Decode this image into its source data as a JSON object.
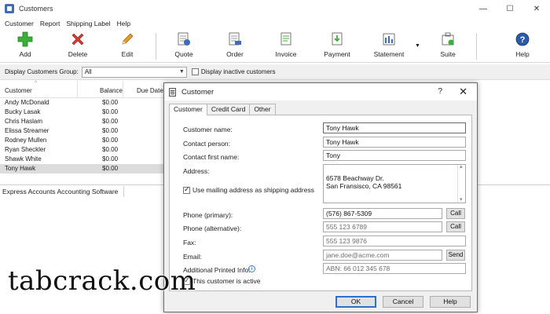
{
  "window": {
    "title": "Customers",
    "controls": {
      "minimize": "—",
      "maximize": "☐",
      "close": "✕"
    }
  },
  "menu": [
    "Customer",
    "Report",
    "Shipping Label",
    "Help"
  ],
  "toolbar": {
    "add": "Add",
    "delete": "Delete",
    "edit": "Edit",
    "quote": "Quote",
    "order": "Order",
    "invoice": "Invoice",
    "payment": "Payment",
    "statement": "Statement",
    "suite": "Suite",
    "help": "Help",
    "colors": {
      "add": "#3cae3c",
      "delete": "#d63b2f",
      "edit": "#e89d28",
      "doc": "#3f6db4",
      "help": "#2a5aa8"
    }
  },
  "filter": {
    "group_label": "Display Customers Group:",
    "group_value": "All",
    "inactive_label": "Display inactive customers"
  },
  "list": {
    "columns": [
      "Customer",
      "Balance",
      "Due Date"
    ],
    "rows": [
      {
        "name": "Andy McDonald",
        "balance": "$0.00"
      },
      {
        "name": "Bucky Lasak",
        "balance": "$0.00"
      },
      {
        "name": "Chris Haslam",
        "balance": "$0.00"
      },
      {
        "name": "Elissa Streamer",
        "balance": "$0.00"
      },
      {
        "name": "Rodney Mullen",
        "balance": "$0.00"
      },
      {
        "name": "Ryan Sheckler",
        "balance": "$0.00"
      },
      {
        "name": "Shawk White",
        "balance": "$0.00"
      },
      {
        "name": "Tony Hawk",
        "balance": "$0.00"
      }
    ],
    "selected_index": 7
  },
  "statusbar": {
    "text": "Express Accounts Accounting Software"
  },
  "dialog": {
    "title": "Customer",
    "help": "?",
    "close": "✕",
    "tabs": [
      "Customer",
      "Credit Card",
      "Other"
    ],
    "active_tab": 0,
    "fields": {
      "customer_name_label": "Customer name:",
      "customer_name": "Tony Hawk",
      "contact_person_label": "Contact person:",
      "contact_person": "Tony Hawk",
      "contact_first_label": "Contact first name:",
      "contact_first": "Tony",
      "address_label": "Address:",
      "address": "6578 Beachway Dr.\nSan Fransisco, CA 98561",
      "use_mailing_label": "Use mailing address as shipping address",
      "phone_primary_label": "Phone (primary):",
      "phone_primary": "(576) 867-5309",
      "phone_alt_label": "Phone (alternative):",
      "phone_alt": "555 123 6789",
      "fax_label": "Fax:",
      "fax": "555 123 9876",
      "email_label": "Email:",
      "email": "jane.doe@acme.com",
      "additional_label": "Additional Printed Info:",
      "additional": "ABN: 66 012 345 678",
      "active_label": "This customer is active"
    },
    "buttons": {
      "call": "Call",
      "send": "Send",
      "ok": "OK",
      "cancel": "Cancel",
      "help": "Help"
    }
  },
  "watermark": "tabcrack.com"
}
